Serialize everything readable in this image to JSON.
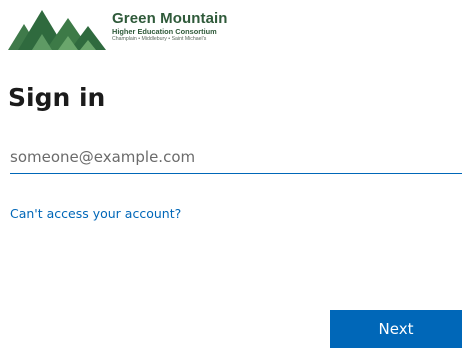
{
  "logo": {
    "title": "Green Mountain",
    "subtitle": "Higher Education Consortium",
    "campuses": "Champlain • Middlebury • Saint Michael's",
    "icon": "mountains-logo-icon"
  },
  "heading": {
    "title": "Sign in"
  },
  "email": {
    "placeholder": "someone@example.com",
    "value": ""
  },
  "links": {
    "cant_access": "Can't access your account?"
  },
  "buttons": {
    "next": "Next"
  },
  "colors": {
    "accent": "#0067b8",
    "logo_green": "#2f5a3a"
  }
}
